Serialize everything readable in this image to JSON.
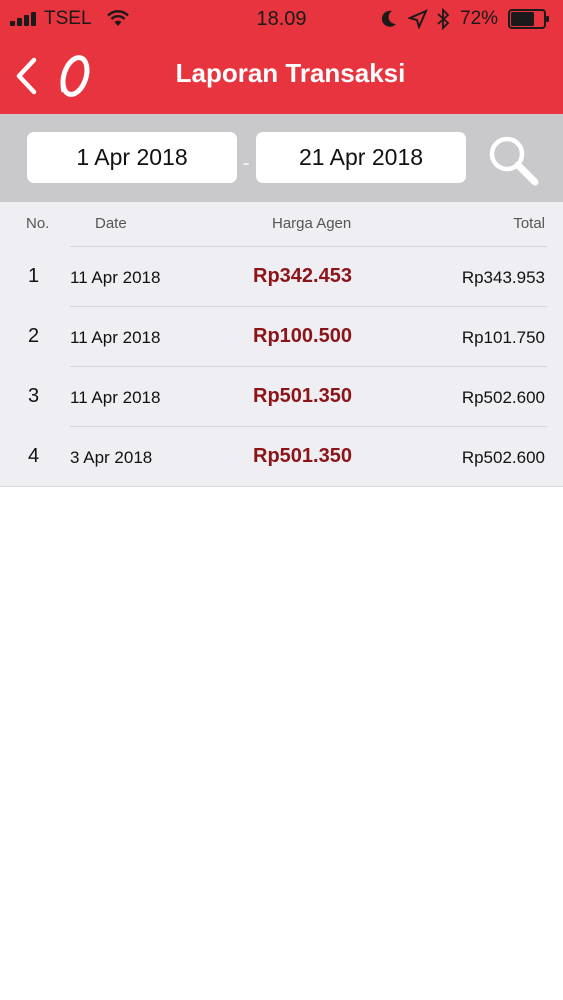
{
  "status_bar": {
    "carrier": "TSEL",
    "time": "18.09",
    "battery_percent": "72%",
    "battery_level": 0.72,
    "icons": [
      "signal-icon",
      "wifi-icon",
      "moon-icon",
      "location-arrow-icon",
      "bluetooth-icon",
      "battery-icon"
    ]
  },
  "nav": {
    "title": "Laporan Transaksi",
    "back_icon": "chevron-left-icon",
    "logo_icon": "brand-logo-icon"
  },
  "filter": {
    "date_from": "1 Apr 2018",
    "separator": "-",
    "date_to": "21 Apr 2018",
    "search_icon": "search-icon"
  },
  "table": {
    "headers": {
      "no": "No.",
      "date": "Date",
      "harga": "Harga Agen",
      "total": "Total"
    },
    "rows": [
      {
        "no": "1",
        "date": "11 Apr 2018",
        "harga": "Rp342.453",
        "total": "Rp343.953"
      },
      {
        "no": "2",
        "date": "11 Apr 2018",
        "harga": "Rp100.500",
        "total": "Rp101.750"
      },
      {
        "no": "3",
        "date": "11 Apr 2018",
        "harga": "Rp501.350",
        "total": "Rp502.600"
      },
      {
        "no": "4",
        "date": "3 Apr 2018",
        "harga": "Rp501.350",
        "total": "Rp502.600"
      }
    ]
  },
  "colors": {
    "header_red": "#e8343f",
    "filter_gray": "#c9c9cb",
    "harga_red": "#8b1418",
    "table_bg": "#efeff3"
  }
}
